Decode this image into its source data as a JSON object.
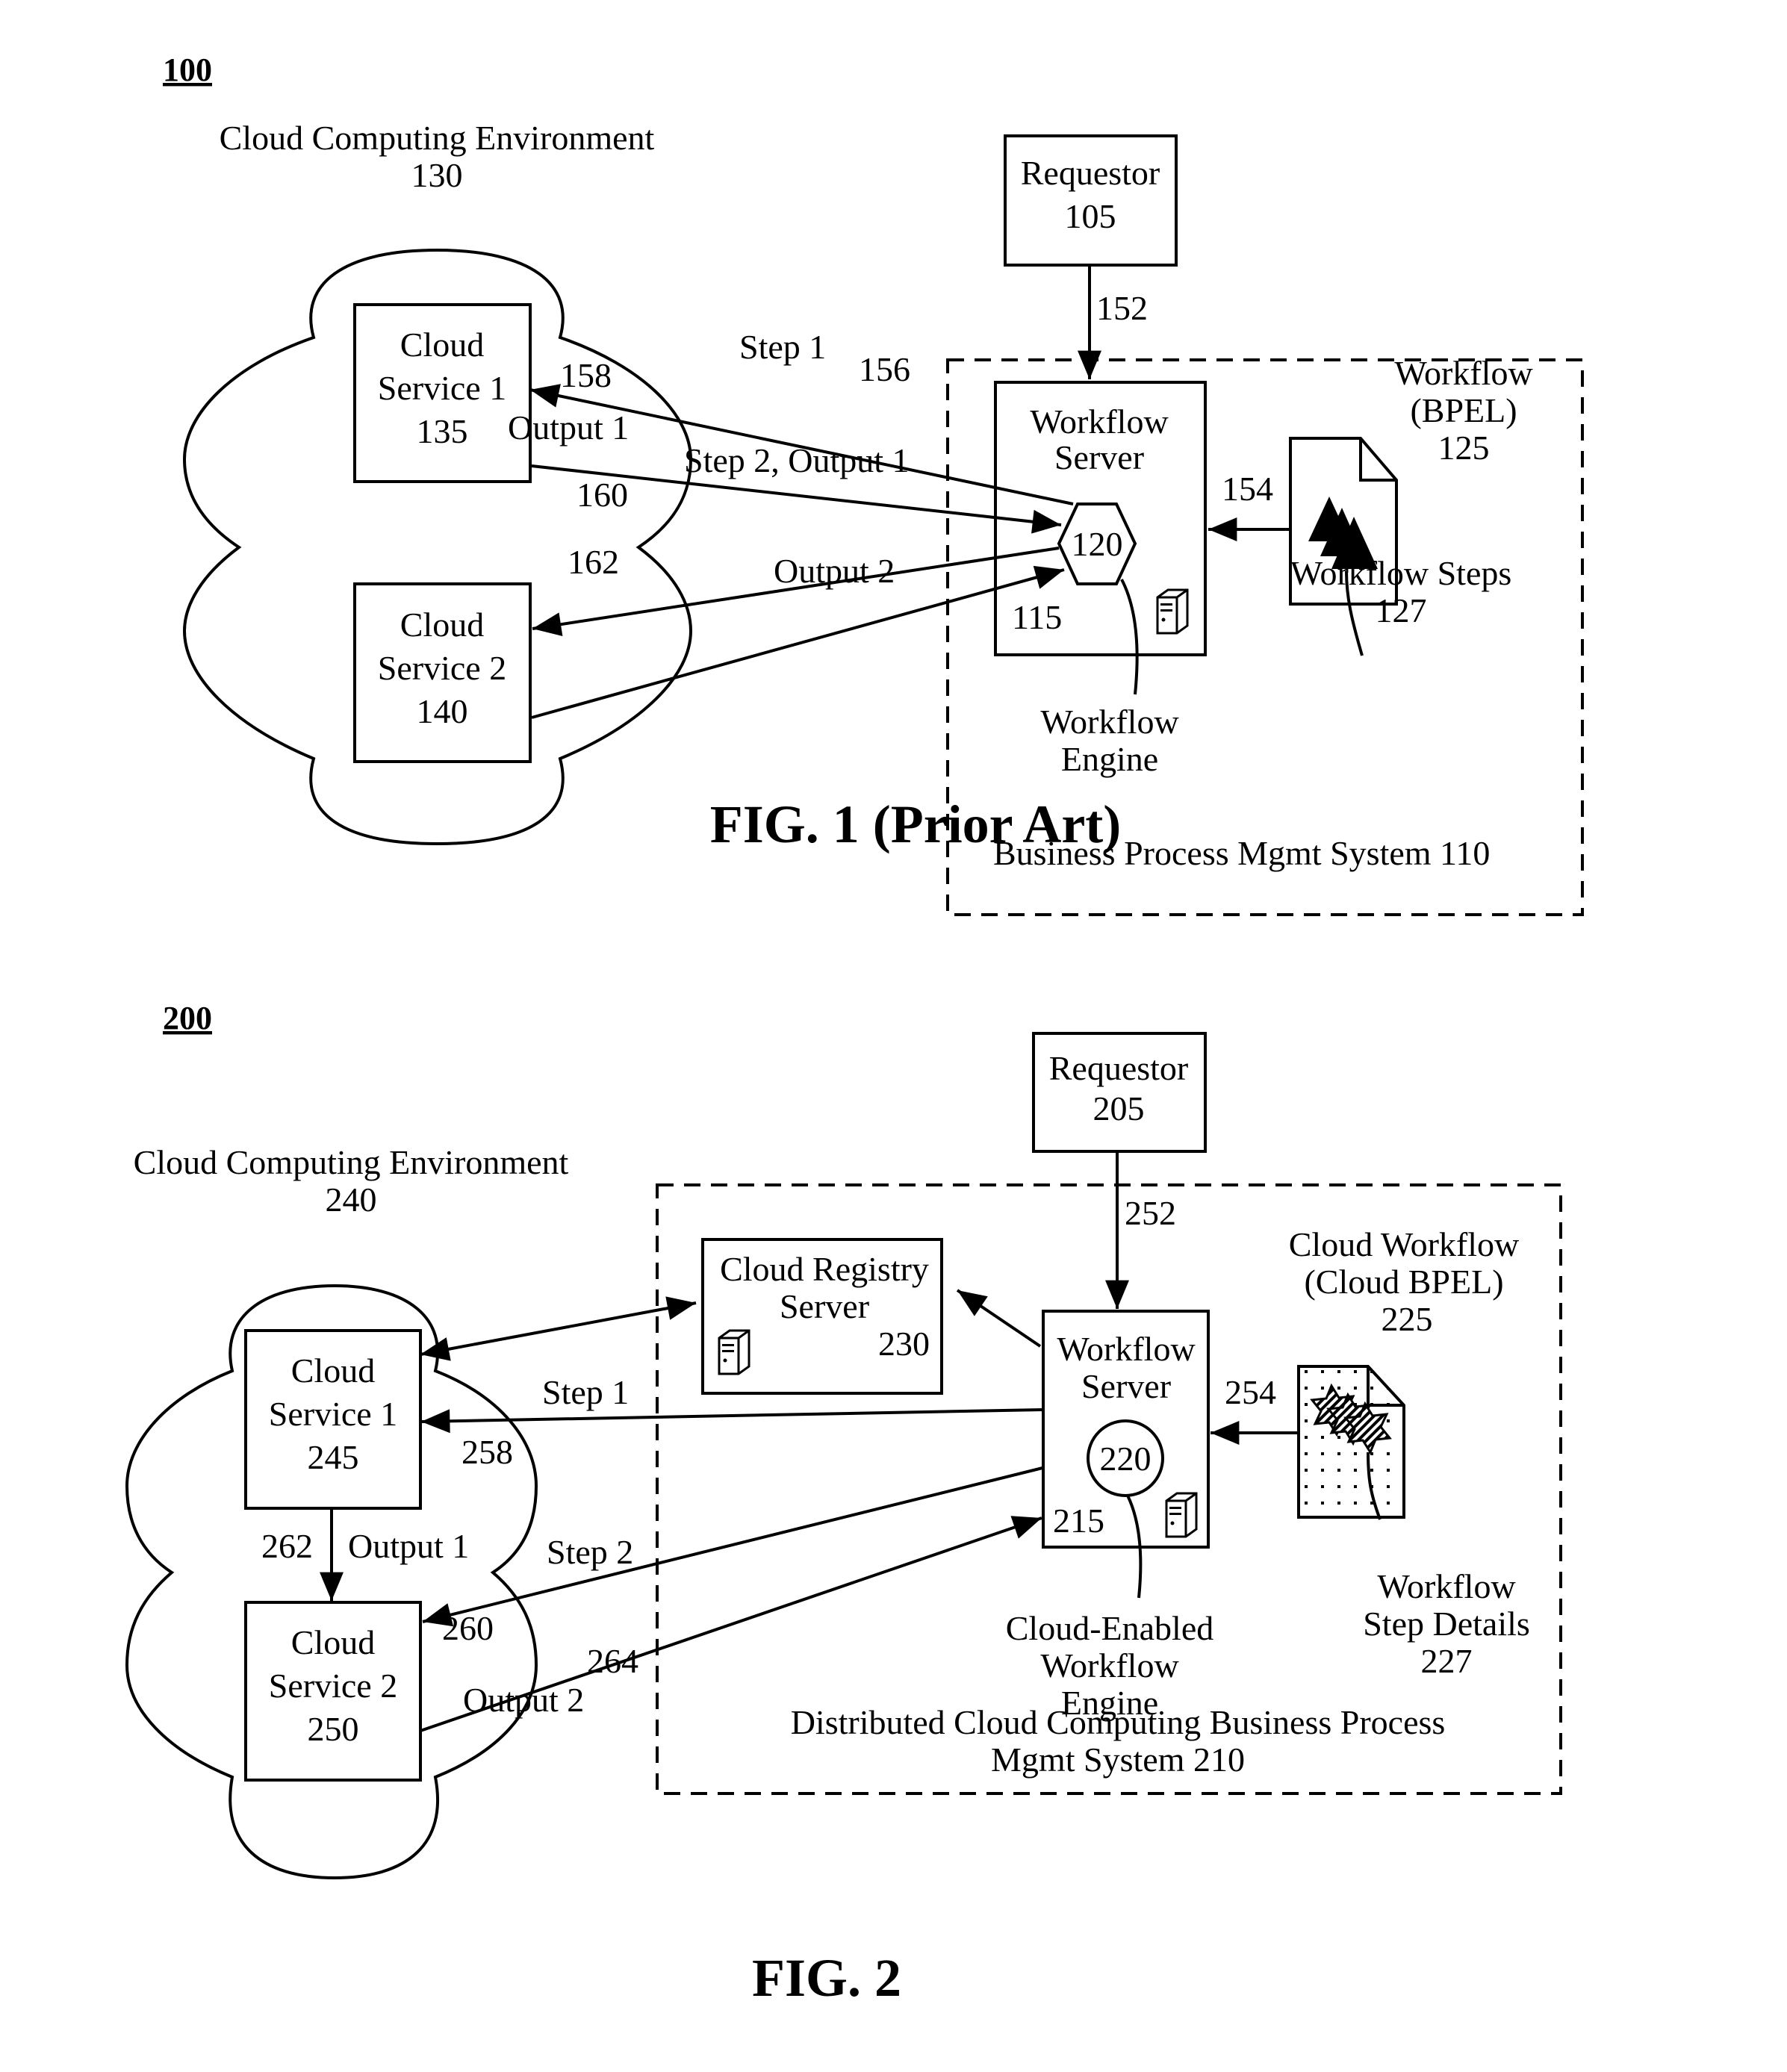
{
  "fig1": {
    "ref": "100",
    "caption": "FIG. 1 (Prior Art)",
    "cloud_env": {
      "label": "Cloud Computing Environment",
      "num": "130"
    },
    "cloud_service_1": {
      "l1": "Cloud",
      "l2": "Service 1",
      "num": "135"
    },
    "cloud_service_2": {
      "l1": "Cloud",
      "l2": "Service 2",
      "num": "140"
    },
    "requestor": {
      "label": "Requestor",
      "num": "105"
    },
    "bpm_system": {
      "label": "Business Process Mgmt System  110"
    },
    "workflow_server": {
      "l1": "Workflow",
      "l2": "Server",
      "num": "115"
    },
    "workflow_engine": {
      "num": "120",
      "l1": "Workflow",
      "l2": "Engine"
    },
    "workflow_doc": {
      "l1": "Workflow",
      "l2": "(BPEL)",
      "num": "125"
    },
    "workflow_steps": {
      "l1": "Workflow Steps",
      "num": "127"
    },
    "arrows": {
      "a152": "152",
      "a154": "154",
      "a156": "156",
      "a158": "158",
      "a160": "160",
      "a162": "162",
      "step1": "Step 1",
      "output1": "Output 1",
      "step2_output1": "Step 2, Output 1",
      "output2": "Output 2"
    }
  },
  "fig2": {
    "ref": "200",
    "caption": "FIG. 2",
    "cloud_env": {
      "label": "Cloud Computing Environment",
      "num": "240"
    },
    "cloud_service_1": {
      "l1": "Cloud",
      "l2": "Service 1",
      "num": "245"
    },
    "cloud_service_2": {
      "l1": "Cloud",
      "l2": "Service 2",
      "num": "250"
    },
    "requestor": {
      "label": "Requestor",
      "num": "205"
    },
    "registry": {
      "l1": "Cloud Registry",
      "l2": "Server",
      "num": "230"
    },
    "bpm_system": {
      "l1": "Distributed Cloud Computing Business Process",
      "l2": "Mgmt System   210"
    },
    "workflow_server": {
      "l1": "Workflow",
      "l2": "Server",
      "num": "215"
    },
    "workflow_engine": {
      "num": "220",
      "l1": "Cloud-Enabled",
      "l2": "Workflow",
      "l3": "Engine"
    },
    "workflow_doc": {
      "l1": "Cloud Workflow",
      "l2": "(Cloud BPEL)",
      "num": "225"
    },
    "workflow_steps": {
      "l1": "Workflow",
      "l2": "Step Details",
      "num": "227"
    },
    "arrows": {
      "a252": "252",
      "a254": "254",
      "a258": "258",
      "a260": "260",
      "a262": "262",
      "a264": "264",
      "step1": "Step 1",
      "step2": "Step 2",
      "output1": "Output 1",
      "output2": "Output 2"
    }
  }
}
